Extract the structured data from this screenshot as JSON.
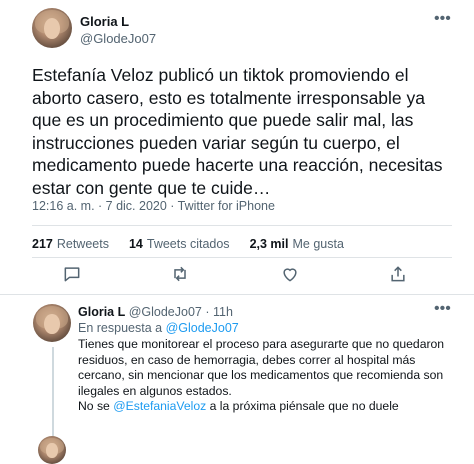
{
  "main_tweet": {
    "display_name": "Gloria L",
    "handle": "@GlodeJo07",
    "text": "Estefanía Veloz publicó un tiktok promoviendo el aborto casero, esto es totalmente irresponsable ya que es un procedimiento que puede salir mal, las instrucciones pueden variar según tu cuerpo, el medicamento puede hacerte una reacción, necesitas estar con gente que te cuide…",
    "timestamp": "12:16 a. m. · 7 dic. 2020 · Twitter for iPhone",
    "more_icon": "more-dots-icon",
    "stats": {
      "retweets_count": "217",
      "retweets_label": "Retweets",
      "quotes_count": "14",
      "quotes_label": "Tweets citados",
      "likes_count": "2,3 mil",
      "likes_label": "Me gusta"
    },
    "actions": [
      "reply-icon",
      "retweet-icon",
      "like-icon",
      "share-icon"
    ]
  },
  "reply_tweet": {
    "display_name": "Gloria L",
    "handle": "@GlodeJo07",
    "age": "· 11h",
    "reply_prefix": "En respuesta a",
    "reply_target": "@GlodeJo07",
    "text_main": "Tienes que monitorear el proceso para asegurarte que no quedaron residuos, en caso de hemorragia, debes correr al hospital más cercano, sin mencionar que los medicamentos que recomienda son ilegales en algunos estados.",
    "text_last_prefix": "No se",
    "text_mention": "@EstefaniaVeloz",
    "text_last_suffix": "a la próxima piénsale que no duele"
  },
  "colors": {
    "text_primary": "#0f1419",
    "text_secondary": "#536471",
    "accent": "#1d9bf0",
    "divider": "#dfe3e6"
  }
}
